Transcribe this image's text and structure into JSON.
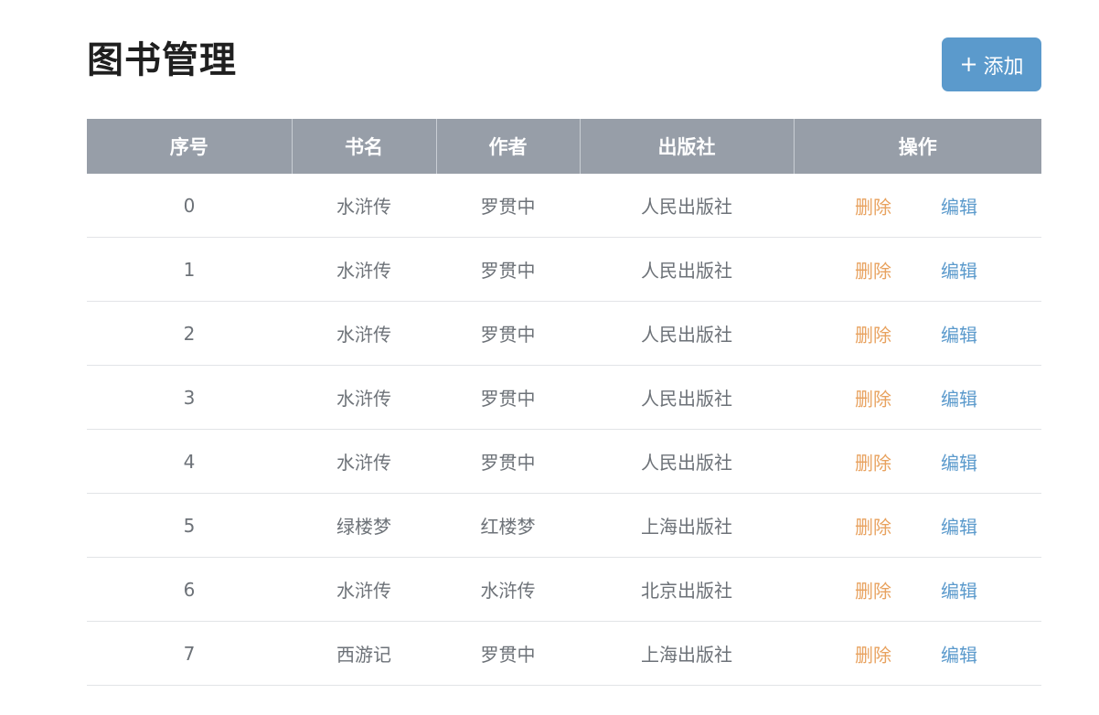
{
  "header": {
    "title": "图书管理",
    "add_icon": "+",
    "add_label": "添加"
  },
  "table": {
    "columns": [
      "序号",
      "书名",
      "作者",
      "出版社",
      "操作"
    ],
    "actions": {
      "delete": "删除",
      "edit": "编辑"
    },
    "rows": [
      {
        "index": "0",
        "title": "水浒传",
        "author": "罗贯中",
        "publisher": "人民出版社"
      },
      {
        "index": "1",
        "title": "水浒传",
        "author": "罗贯中",
        "publisher": "人民出版社"
      },
      {
        "index": "2",
        "title": "水浒传",
        "author": "罗贯中",
        "publisher": "人民出版社"
      },
      {
        "index": "3",
        "title": "水浒传",
        "author": "罗贯中",
        "publisher": "人民出版社"
      },
      {
        "index": "4",
        "title": "水浒传",
        "author": "罗贯中",
        "publisher": "人民出版社"
      },
      {
        "index": "5",
        "title": "绿楼梦",
        "author": "红楼梦",
        "publisher": "上海出版社"
      },
      {
        "index": "6",
        "title": "水浒传",
        "author": "水浒传",
        "publisher": "北京出版社"
      },
      {
        "index": "7",
        "title": "西游记",
        "author": "罗贯中",
        "publisher": "上海出版社"
      }
    ]
  },
  "colors": {
    "header_bg": "#979ea8",
    "primary": "#5b9acc",
    "delete": "#e8a25f",
    "text": "#6d7278"
  }
}
